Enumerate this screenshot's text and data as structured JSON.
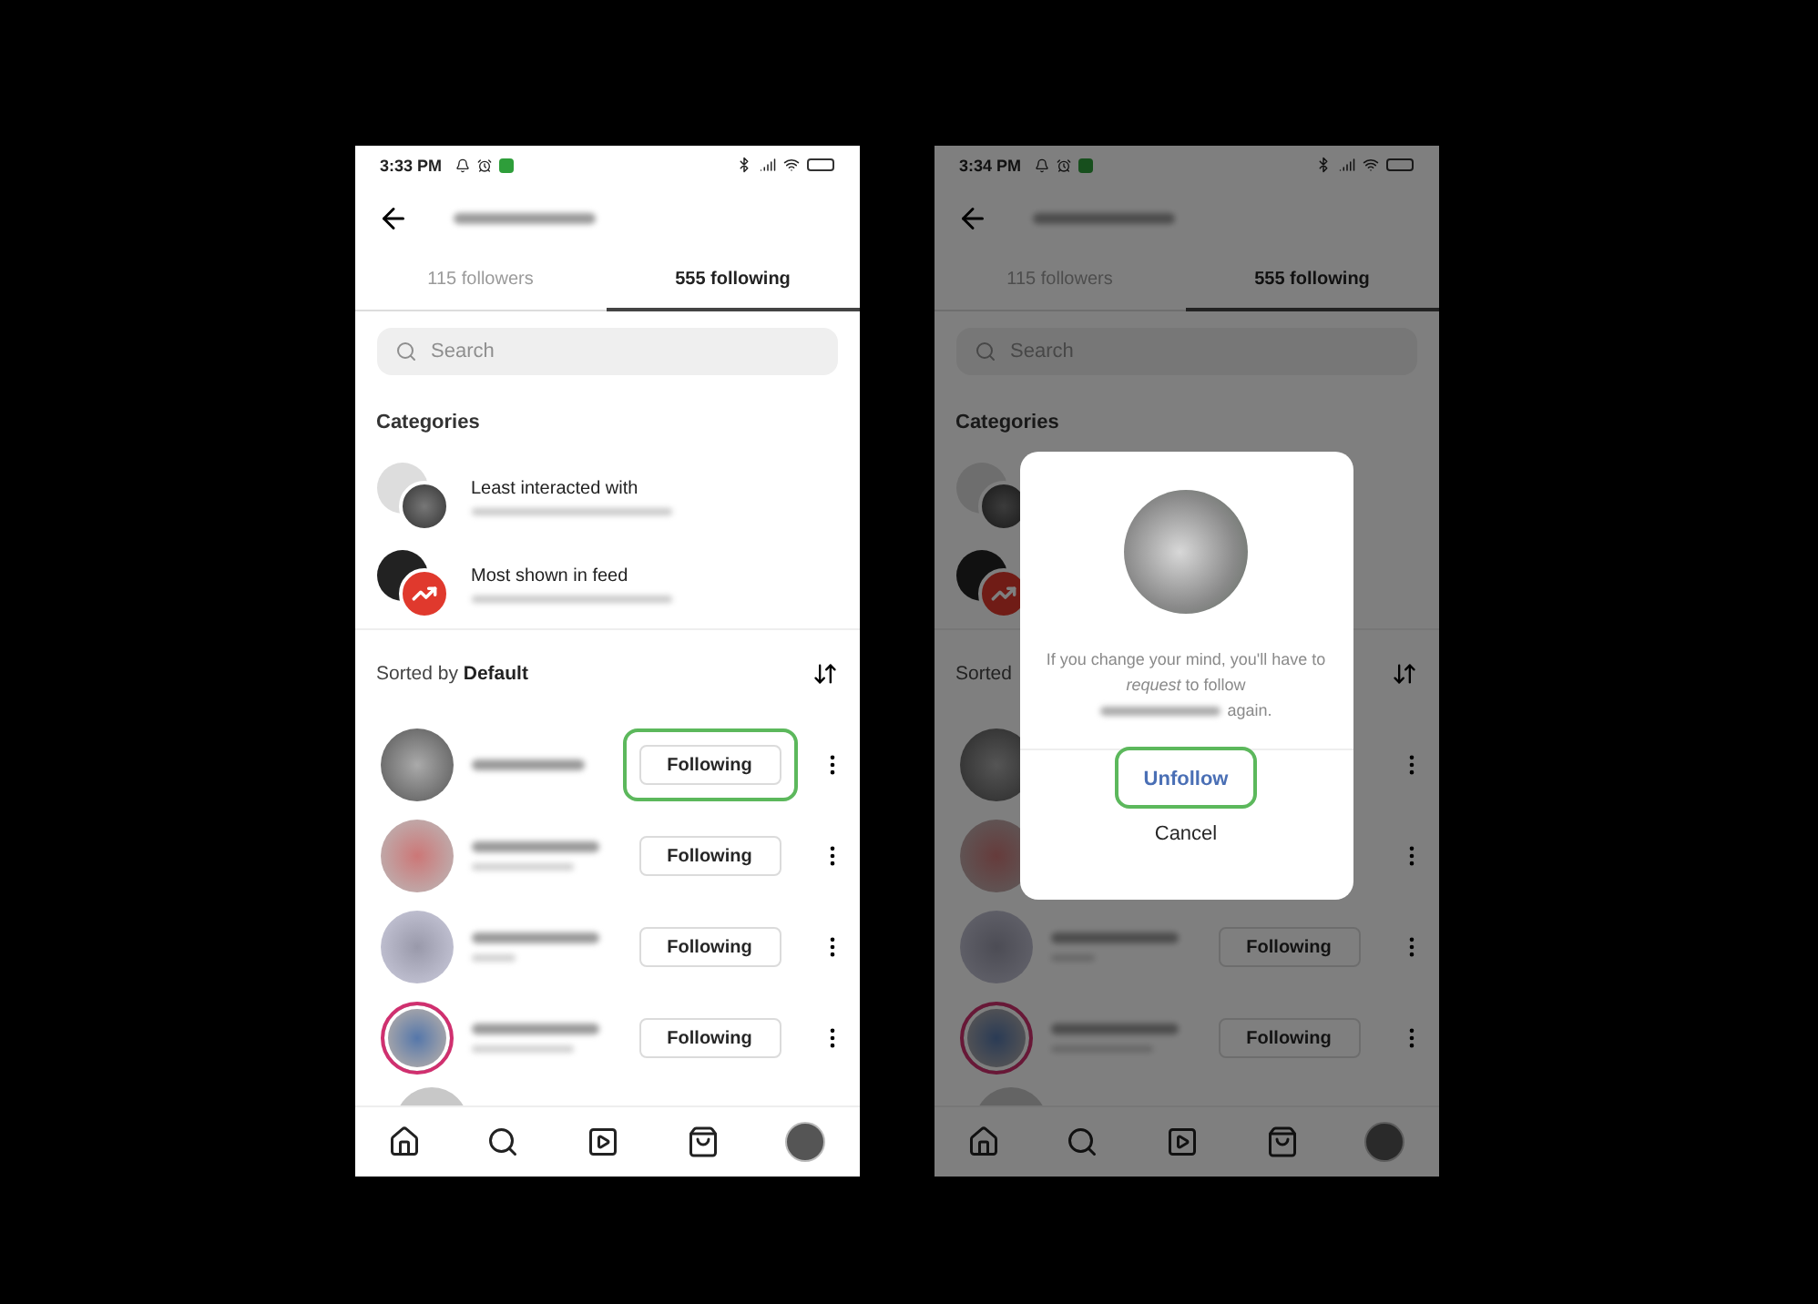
{
  "screens": [
    {
      "status_bar": {
        "time": "3:33 PM"
      },
      "tabs": [
        {
          "label": "115 followers",
          "selected": false
        },
        {
          "label": "555 following",
          "selected": true
        }
      ],
      "search": {
        "placeholder": "Search"
      },
      "categories_title": "Categories",
      "categories": [
        {
          "kind": "photo",
          "label": "Least interacted with"
        },
        {
          "kind": "trending",
          "label": "Most shown in feed"
        }
      ],
      "sort": {
        "label": "Sorted by **Default**"
      },
      "accounts": [
        {
          "button": "Following",
          "highlighted": true,
          "story_ring": false
        },
        {
          "button": "Following",
          "highlighted": false,
          "story_ring": false
        },
        {
          "button": "Following",
          "highlighted": false,
          "story_ring": false
        },
        {
          "button": "Following",
          "highlighted": false,
          "story_ring": true
        }
      ]
    },
    {
      "status_bar": {
        "time": "3:34 PM"
      },
      "tabs": [
        {
          "label": "115 followers",
          "selected": false
        },
        {
          "label": "555 following",
          "selected": true
        }
      ],
      "search": {
        "placeholder": "Search"
      },
      "categories_title": "Categories",
      "categories": [
        {
          "kind": "photo"
        },
        {
          "kind": "trending"
        }
      ],
      "sort": {
        "label": "Sorted"
      },
      "accounts": [
        {
          "highlighted": false,
          "story_ring": false
        },
        {
          "highlighted": false,
          "story_ring": false
        },
        {
          "button": "Following",
          "highlighted": false,
          "story_ring": false
        },
        {
          "button": "Following",
          "highlighted": false,
          "story_ring": true
        }
      ],
      "dialog": {
        "message": "If you change your mind, you'll have to *request* to follow",
        "message_end": "again.",
        "confirm": {
          "label": "Unfollow",
          "highlighted": true
        },
        "cancel": "Cancel"
      }
    }
  ]
}
